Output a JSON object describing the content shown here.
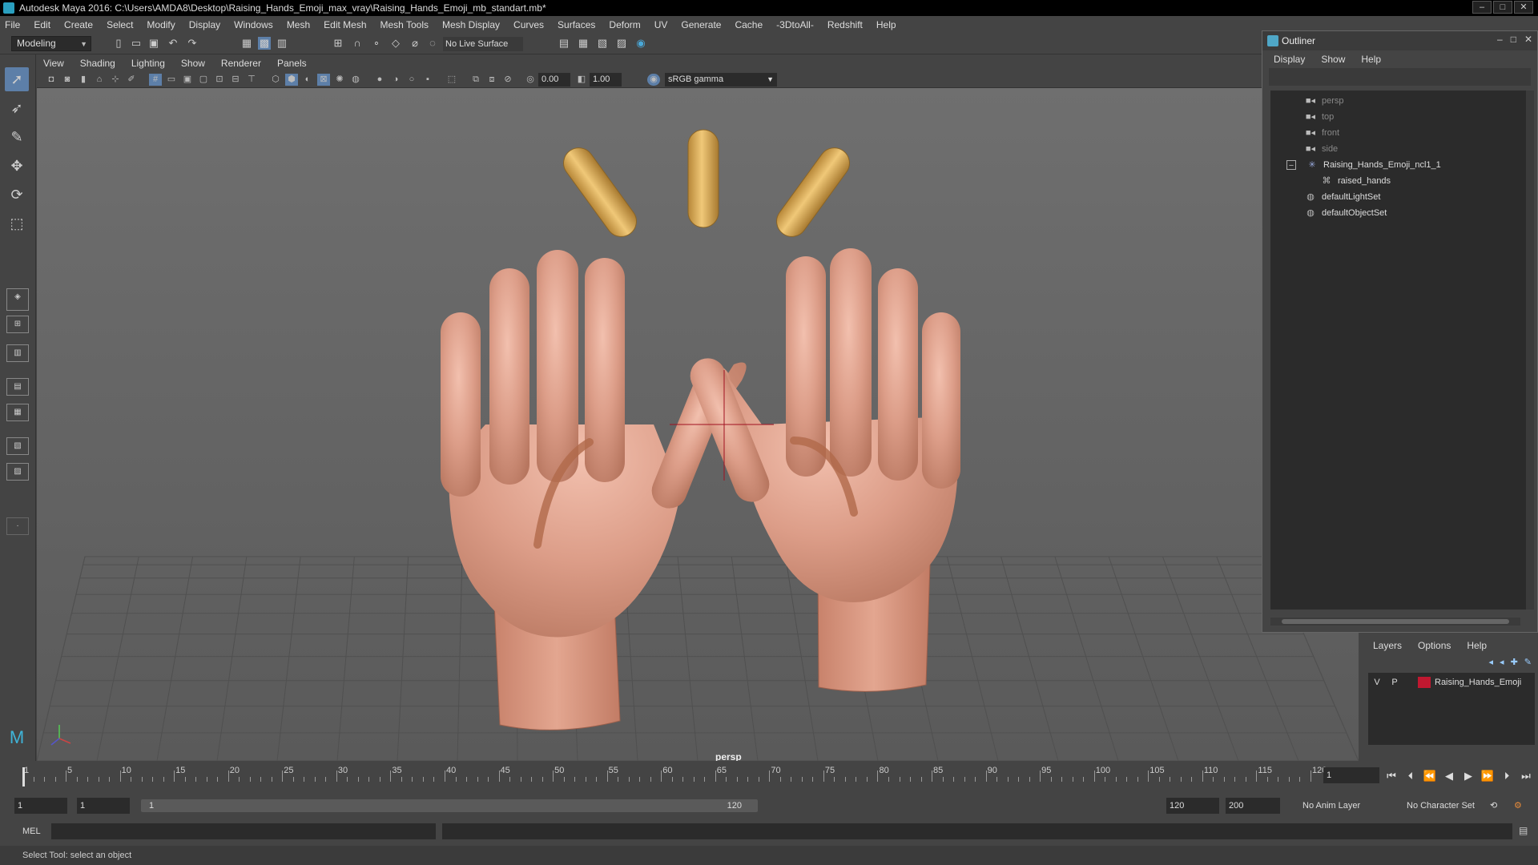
{
  "window": {
    "title": "Autodesk Maya 2016: C:\\Users\\AMDA8\\Desktop\\Raising_Hands_Emoji_max_vray\\Raising_Hands_Emoji_mb_standart.mb*"
  },
  "menubar": [
    "File",
    "Edit",
    "Create",
    "Select",
    "Modify",
    "Display",
    "Windows",
    "Mesh",
    "Edit Mesh",
    "Mesh Tools",
    "Mesh Display",
    "Curves",
    "Surfaces",
    "Deform",
    "UV",
    "Generate",
    "Cache",
    "-3DtoAll-",
    "Redshift",
    "Help"
  ],
  "statusline": {
    "mode": "Modeling",
    "live_surface": "No Live Surface"
  },
  "panel_menu": [
    "View",
    "Shading",
    "Lighting",
    "Show",
    "Renderer",
    "Panels"
  ],
  "panel_toolbar": {
    "exposure": "0.00",
    "gamma_value": "1.00",
    "color_space": "sRGB gamma"
  },
  "viewport": {
    "camera": "persp",
    "skin_color": "#d99b86",
    "sparkle_color": "#d8a954",
    "background_top": "#6f6f6f"
  },
  "outliner": {
    "title": "Outliner",
    "menu": [
      "Display",
      "Show",
      "Help"
    ],
    "items": [
      {
        "label": "persp",
        "icon": "camera-icon"
      },
      {
        "label": "top",
        "icon": "camera-icon"
      },
      {
        "label": "front",
        "icon": "camera-icon"
      },
      {
        "label": "side",
        "icon": "camera-icon"
      },
      {
        "label": "Raising_Hands_Emoji_ncl1_1",
        "icon": "group-icon"
      },
      {
        "label": "raised_hands",
        "icon": "mesh-icon"
      },
      {
        "label": "defaultLightSet",
        "icon": "set-icon"
      },
      {
        "label": "defaultObjectSet",
        "icon": "set-icon"
      }
    ]
  },
  "layers": {
    "menu": [
      "Layers",
      "Options",
      "Help"
    ],
    "rows": [
      {
        "v": "V",
        "p": "P",
        "name": "Raising_Hands_Emoji",
        "color": "#c01830"
      }
    ]
  },
  "timeslider": {
    "labels": [
      "1",
      "5",
      "10",
      "15",
      "20",
      "25",
      "30",
      "35",
      "40",
      "45",
      "50",
      "55",
      "60",
      "65",
      "70",
      "75",
      "80",
      "85",
      "90",
      "95",
      "100",
      "105",
      "110",
      "115",
      "120"
    ],
    "current_frame": "1"
  },
  "range": {
    "start": "1",
    "playback_start": "1",
    "bar_start": "1",
    "bar_end": "120",
    "playback_end": "120",
    "end": "200",
    "anim_layer": "No Anim Layer",
    "character_set": "No Character Set"
  },
  "cmdline": {
    "type": "MEL"
  },
  "helpline": {
    "text": "Select Tool: select an object"
  }
}
